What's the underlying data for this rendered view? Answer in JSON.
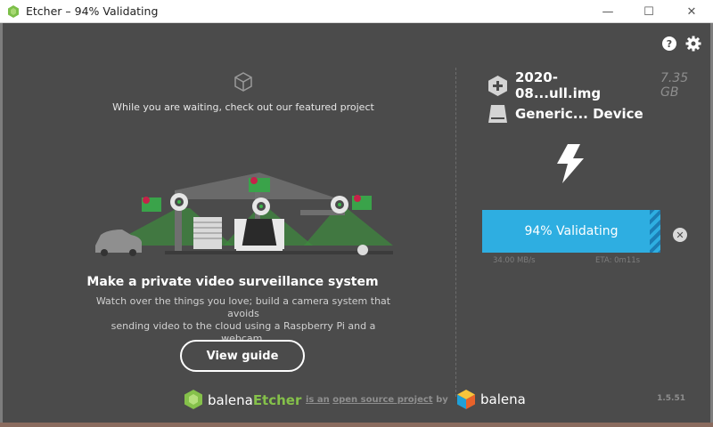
{
  "window": {
    "title": "Etcher – 94% Validating",
    "min_glyph": "—",
    "max_glyph": "☐",
    "close_glyph": "✕"
  },
  "colors": {
    "background": "#4b4b4b",
    "accent": "#2eaee1",
    "brand_green": "#85c14a"
  },
  "header_icons": [
    "help-icon",
    "settings-icon"
  ],
  "featured": {
    "waiting_text": "While you are waiting, check out our featured project",
    "project_title": "Make a private video surveillance system",
    "project_description_line1": "Watch over the things you love; build a camera system that avoids",
    "project_description_line2": "sending video to the cloud using a Raspberry Pi and a webcam.",
    "button_label": "View guide"
  },
  "image": {
    "name": "2020-08...ull.img",
    "size": "7.35 GB",
    "icon": "plus-icon"
  },
  "drive": {
    "name": "Generic... Device",
    "icon": "drive-icon"
  },
  "flash": {
    "icon": "lightning-icon",
    "label": "94% Validating",
    "percent": 94,
    "speed": "34.00 MB/s",
    "eta": "ETA: 0m11s",
    "cancel_icon": "cancel-icon"
  },
  "footer": {
    "logo_part1": "balena",
    "logo_part2": "Etcher",
    "is_an": "is an",
    "open_source_project": "open source project",
    "by": "by",
    "balena": "balena",
    "version": "1.5.51"
  }
}
